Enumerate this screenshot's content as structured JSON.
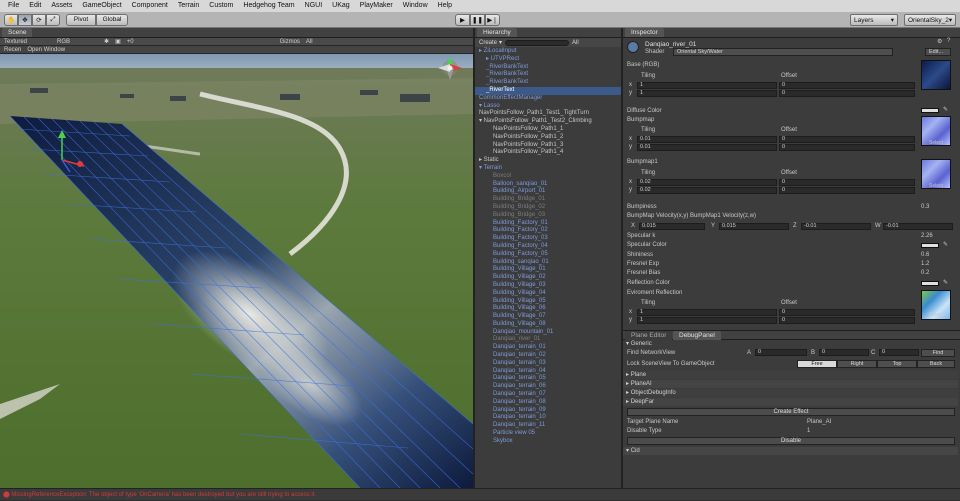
{
  "menu": [
    "File",
    "Edit",
    "Assets",
    "GameObject",
    "Component",
    "Terrain",
    "Custom",
    "Hedgehog Team",
    "NGUI",
    "UKag",
    "PlayMaker",
    "Window",
    "Help"
  ],
  "toolbar": {
    "pivot_label": "Pivot",
    "global_label": "Global",
    "layers_label": "Layers",
    "layout_label": "OrientalSky_2"
  },
  "scene": {
    "tab_label": "Scene",
    "textured_label": "Textured",
    "rgb_label": "RGB",
    "effects_label": "+0",
    "gizmos_label": "Gizmos",
    "all_label": "All",
    "row2_a": "Recen",
    "row2_b": "Open Window"
  },
  "hierarchy": {
    "tab_label": "Hierarchy",
    "create_label": "Create",
    "all_label": "All",
    "items": [
      {
        "text": "▸ ZiLocalInput",
        "style": "prefab",
        "indent": 0
      },
      {
        "text": "▸ UTVPRect",
        "style": "prefab",
        "indent": 1
      },
      {
        "text": "_RiverBankText",
        "style": "prefab",
        "indent": 1
      },
      {
        "text": "_RiverBankText",
        "style": "prefab",
        "indent": 1
      },
      {
        "text": "_RiverBankText",
        "style": "prefab",
        "indent": 1
      },
      {
        "text": "_RiverText",
        "style": "sel",
        "indent": 1
      },
      {
        "text": "CommonEffectManager",
        "style": "prefab",
        "indent": 0
      },
      {
        "text": "▾ Lasso",
        "style": "prefab",
        "indent": 0
      },
      {
        "text": "NavPointsFollow_Path1_Test1_TightTurn",
        "style": "normal",
        "indent": 0
      },
      {
        "text": "▾ NavPointsFollow_Path1_Test2_Climbing",
        "style": "normal",
        "indent": 0
      },
      {
        "text": "NavPointsFollow_Path1_1",
        "style": "normal",
        "indent": 2
      },
      {
        "text": "NavPointsFollow_Path1_2",
        "style": "normal",
        "indent": 2
      },
      {
        "text": "NavPointsFollow_Path1_3",
        "style": "normal",
        "indent": 2
      },
      {
        "text": "NavPointsFollow_Path1_4",
        "style": "normal",
        "indent": 2
      },
      {
        "text": "▸ Static",
        "style": "normal",
        "indent": 0
      },
      {
        "text": "▾ Terrain",
        "style": "prefab",
        "indent": 0
      },
      {
        "text": "Boxcol",
        "style": "dim",
        "indent": 2
      },
      {
        "text": "Balloon_sanqiao_01",
        "style": "prefab",
        "indent": 2
      },
      {
        "text": "Building_Airport_01",
        "style": "prefab",
        "indent": 2
      },
      {
        "text": "Building_Bridge_01",
        "style": "dim",
        "indent": 2
      },
      {
        "text": "Building_Bridge_02",
        "style": "dim",
        "indent": 2
      },
      {
        "text": "Building_Bridge_03",
        "style": "dim",
        "indent": 2
      },
      {
        "text": "Building_Factory_01",
        "style": "prefab",
        "indent": 2
      },
      {
        "text": "Building_Factory_02",
        "style": "prefab",
        "indent": 2
      },
      {
        "text": "Building_Factory_03",
        "style": "prefab",
        "indent": 2
      },
      {
        "text": "Building_Factory_04",
        "style": "prefab",
        "indent": 2
      },
      {
        "text": "Building_Factory_05",
        "style": "prefab",
        "indent": 2
      },
      {
        "text": "Building_sanqiao_01",
        "style": "prefab",
        "indent": 2
      },
      {
        "text": "Building_Village_01",
        "style": "prefab",
        "indent": 2
      },
      {
        "text": "Building_Village_02",
        "style": "prefab",
        "indent": 2
      },
      {
        "text": "Building_Village_03",
        "style": "prefab",
        "indent": 2
      },
      {
        "text": "Building_Village_04",
        "style": "prefab",
        "indent": 2
      },
      {
        "text": "Building_Village_05",
        "style": "prefab",
        "indent": 2
      },
      {
        "text": "Building_Village_06",
        "style": "prefab",
        "indent": 2
      },
      {
        "text": "Building_Village_07",
        "style": "prefab",
        "indent": 2
      },
      {
        "text": "Building_Village_08",
        "style": "prefab",
        "indent": 2
      },
      {
        "text": "Danqiao_mountain_01",
        "style": "prefab",
        "indent": 2
      },
      {
        "text": "Danqiao_river_01",
        "style": "dim",
        "indent": 2
      },
      {
        "text": "Danqiao_terrain_01",
        "style": "prefab",
        "indent": 2
      },
      {
        "text": "Danqiao_terrain_02",
        "style": "prefab",
        "indent": 2
      },
      {
        "text": "Danqiao_terrain_03",
        "style": "prefab",
        "indent": 2
      },
      {
        "text": "Danqiao_terrain_04",
        "style": "prefab",
        "indent": 2
      },
      {
        "text": "Danqiao_terrain_05",
        "style": "prefab",
        "indent": 2
      },
      {
        "text": "Danqiao_terrain_06",
        "style": "prefab",
        "indent": 2
      },
      {
        "text": "Danqiao_terrain_07",
        "style": "prefab",
        "indent": 2
      },
      {
        "text": "Danqiao_terrain_08",
        "style": "prefab",
        "indent": 2
      },
      {
        "text": "Danqiao_terrain_09",
        "style": "prefab",
        "indent": 2
      },
      {
        "text": "Danqiao_terrain_10",
        "style": "prefab",
        "indent": 2
      },
      {
        "text": "Danqiao_terrain_11",
        "style": "prefab",
        "indent": 2
      },
      {
        "text": "Particle view 05",
        "style": "prefab",
        "indent": 2
      },
      {
        "text": "Skybox",
        "style": "prefab",
        "indent": 2
      }
    ]
  },
  "inspector": {
    "tab_label": "Inspector",
    "object_name": "Danqiao_river_01",
    "shader_label": "Shader",
    "shader_value": "Oriental Sky/Water",
    "edit_label": "Edit...",
    "base_label": "Base (RGB)",
    "tiling": "Tiling",
    "offset": "Offset",
    "x": "x",
    "y": "y",
    "base_tiling": [
      "1",
      "1"
    ],
    "base_offset": [
      "0",
      "0"
    ],
    "diffuse_label": "Diffuse Color",
    "bumpmap_label": "Bumpmap",
    "bump_tiling": [
      "0.01",
      "0.01"
    ],
    "bump_offset": [
      "0",
      "0"
    ],
    "bumpmap1_label": "Bumpmap1",
    "bump1_tiling": [
      "0.02",
      "0.02"
    ],
    "bump1_offset": [
      "0",
      "0"
    ],
    "select": "Select",
    "bumpiness_label": "Bumpiness",
    "bumpiness_value": "0.3",
    "velocity_label": "BumpMap Velocity(x,y) BumpMap1 Velocity(z,w)",
    "vx_label": "X",
    "vx": "0.015",
    "vy_label": "Y",
    "vy": "0.015",
    "vz_label": "Z",
    "vz": "-0.01",
    "vw_label": "W",
    "vw": "-0.01",
    "props": [
      {
        "label": "Specular k",
        "value": "2.26"
      },
      {
        "label": "Specular Color",
        "value": ""
      },
      {
        "label": "Shininess",
        "value": "0.6"
      },
      {
        "label": "Fresnel Exp",
        "value": "1.2"
      },
      {
        "label": "Fresnel Bias",
        "value": "0.2"
      },
      {
        "label": "Reflection Color",
        "value": ""
      }
    ],
    "env_label": "Eviroment Reflection",
    "env_tiling": [
      "1",
      "1"
    ],
    "env_offset": [
      "0",
      "0"
    ]
  },
  "plane_editor": {
    "tab1": "Plane Editor",
    "tab2": "DebugPanel",
    "generic": "Generic",
    "find_label": "Find NetworkView",
    "a_label": "A",
    "a": "0",
    "b_label": "B",
    "b": "0",
    "c_label": "C",
    "c": "0",
    "find_btn": "Find",
    "lock_label": "Lock SceneView To GameObject",
    "free": "Free",
    "right": "Right",
    "top": "Top",
    "back": "Back",
    "sections": [
      "Plane",
      "PlaneAI",
      "ObjectDebugInfo",
      "DeepFar"
    ],
    "create_effect": "Create Effect",
    "target_label": "Target Plane Name",
    "target_value": "Plane_AI",
    "disable_type_label": "Disable Type",
    "disable_type_value": "1",
    "disable_btn": "Disable",
    "cid": "Cid"
  },
  "status": "MissingReferenceException: The object of type 'OnCamera' has been destroyed but you are still trying to access it.",
  "colors": {
    "selection": "#3b5a8a",
    "prefab_text": "#7d9bdc",
    "error": "#d23a3a"
  }
}
